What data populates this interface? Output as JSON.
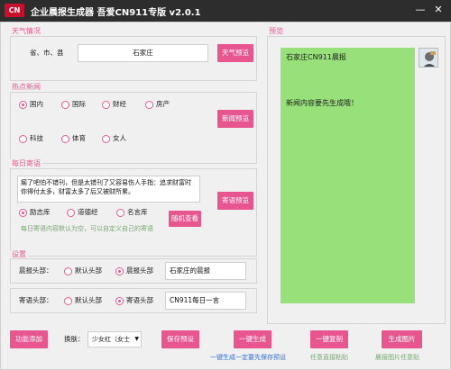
{
  "titlebar": {
    "logo_text": "CN",
    "title": "企业晨报生成器  吾爱CN911专版 v2.0.1",
    "minimize": "—",
    "close": "✕"
  },
  "weather": {
    "group_title": "天气情况",
    "region_label": "省、市、县",
    "region_value": "石家庄",
    "preview_button": "天气预览"
  },
  "news": {
    "group_title": "热点新闻",
    "categories": [
      "国内",
      "国际",
      "财经",
      "房产",
      "科技",
      "体育",
      "女人"
    ],
    "selected": "国内",
    "preview_button": "新闻预览"
  },
  "quote": {
    "group_title": "每日寄语",
    "text": "瘸了吧怕不错刊，但是太错刊了又容易伤人手指：追求财富时你得付太多，财富太多了后又被财所累。",
    "sources": [
      "励志库",
      "道德经",
      "名言库"
    ],
    "selected_source": "励志库",
    "random_button": "随机查看",
    "preview_button": "寄语预览",
    "hint": "每日寄语内容默认为空，可以自定义自己的寄语"
  },
  "settings": {
    "group_title": "设置",
    "header": {
      "label": "晨报头部：",
      "option_default": "默认头部",
      "option_custom": "晨报头部",
      "value": "石家庄的晨报"
    },
    "quote_header": {
      "label": "寄语头部：",
      "option_default": "默认头部",
      "option_custom": "寄语头部",
      "value": "CN911每日一言"
    }
  },
  "bottom": {
    "add_button": "功能添加",
    "skin_label": "换肤：",
    "skin_value": "少女红（女士",
    "save_button": "保存预设",
    "generate_button": "一键生成",
    "copy_button": "一键复制",
    "image_button": "生成图片",
    "generate_hint": "一键生成一定要先保存预设",
    "copy_hint": "任意直接粘贴",
    "image_hint": "晨报图片任意贴"
  },
  "preview": {
    "group_title": "预览",
    "header_line": "石家庄CN911晨报",
    "content_line": "新闻内容要先生成哦！"
  },
  "colors": {
    "accent": "#e8568f",
    "preview_bg": "#98e07a",
    "titlebar_bg": "#2d2d2d",
    "hint_blue": "#2e6fd8",
    "hint_green": "#7aa874"
  }
}
